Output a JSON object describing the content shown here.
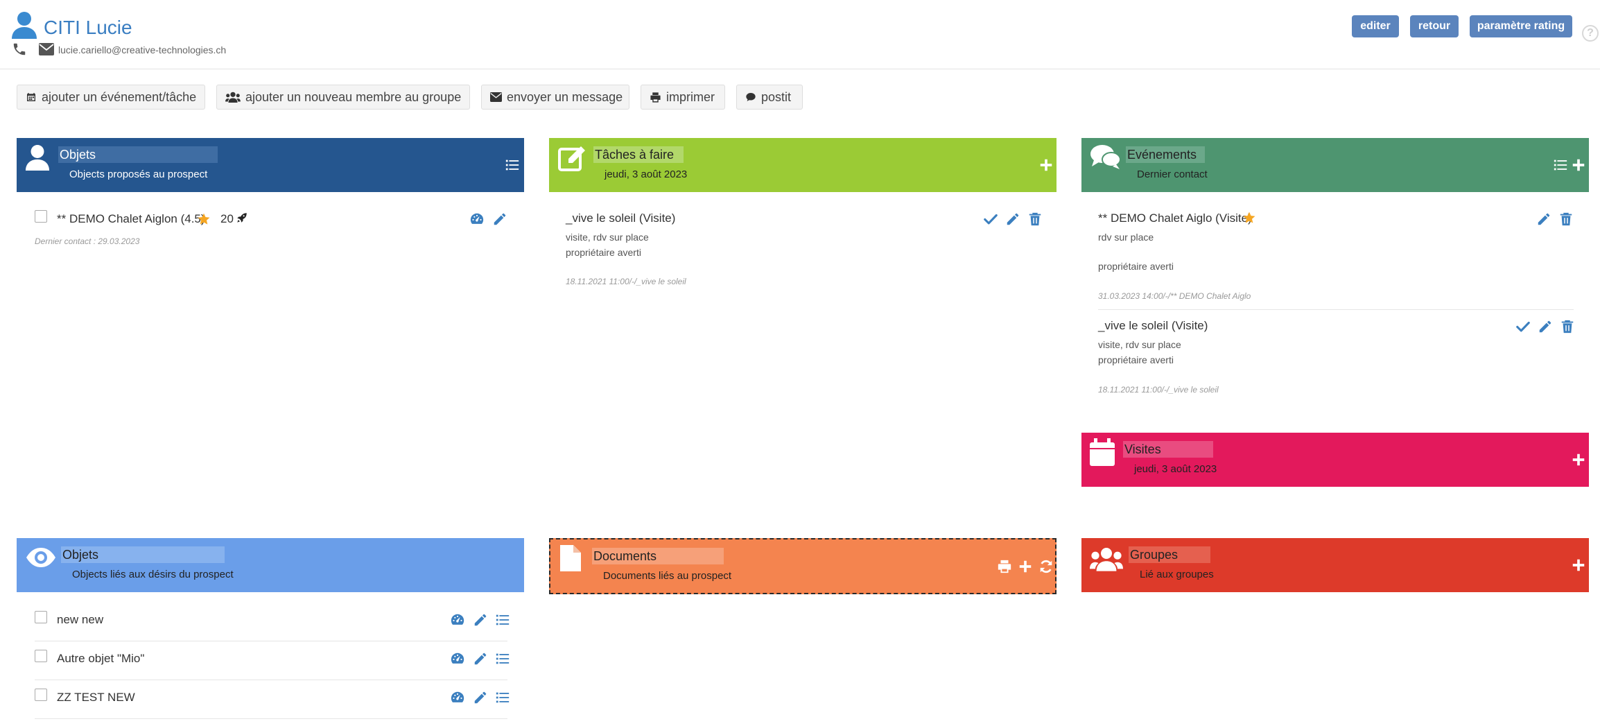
{
  "header": {
    "contact_name": "CITI Lucie",
    "email": "lucie.cariello@creative-technologies.ch",
    "buttons": {
      "edit": "editer",
      "back": "retour",
      "rating": "paramètre rating"
    },
    "help": "?"
  },
  "actions": {
    "add_event": "ajouter un événement/tâche",
    "add_member": "ajouter un nouveau membre au groupe",
    "send_message": "envoyer un message",
    "print": "imprimer",
    "postit": "postit"
  },
  "colors": {
    "objets_proposes": "#25568f",
    "taches": "#9bcb35",
    "evenements": "#4e9570",
    "visites": "#e3195c",
    "objets_desirs": "#6a9ee9",
    "documents": "#f4844f",
    "groupes": "#dd3a2a",
    "action_icon": "#3b7fbf"
  },
  "objets_proposes": {
    "title": "Objets",
    "subtitle": "Objects proposés au prospect",
    "items": [
      {
        "name": "** DEMO Chalet Aiglon (4.5)",
        "count": "20",
        "meta": "Dernier contact : 29.03.2023"
      }
    ]
  },
  "taches": {
    "title": "Tâches à faire",
    "subtitle": "jeudi, 3 août 2023",
    "items": [
      {
        "title": "_vive le soleil (Visite)",
        "line1": "visite, rdv sur place",
        "line2": "propriétaire averti",
        "meta": "18.11.2021 11:00/-/_vive le soleil"
      }
    ]
  },
  "evenements": {
    "title": "Evénements",
    "subtitle": "Dernier contact",
    "items": [
      {
        "title": "** DEMO Chalet Aiglo (Visite)",
        "line1": "rdv sur place",
        "line2": "propriétaire averti",
        "meta": "31.03.2023 14:00/-/** DEMO Chalet Aiglo"
      },
      {
        "title": "_vive le soleil (Visite)",
        "line1": "visite, rdv sur place",
        "line2": "propriétaire averti",
        "meta": "18.11.2021 11:00/-/_vive le soleil"
      }
    ]
  },
  "visites": {
    "title": "Visites",
    "subtitle": "jeudi, 3 août 2023"
  },
  "objets_desirs": {
    "title": "Objets",
    "subtitle": "Objects liés aux désirs du prospect",
    "items": [
      {
        "name": "new new"
      },
      {
        "name": "Autre objet \"Mio\""
      },
      {
        "name": "ZZ TEST NEW"
      }
    ]
  },
  "documents": {
    "title": "Documents",
    "subtitle": "Documents liés au prospect"
  },
  "groupes": {
    "title": "Groupes",
    "subtitle": "Lié aux groupes"
  }
}
